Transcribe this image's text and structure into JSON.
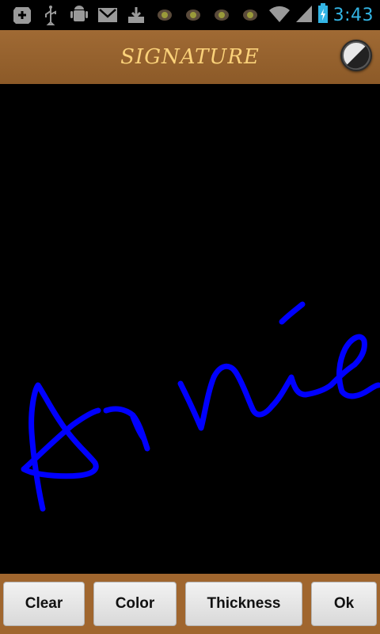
{
  "status_bar": {
    "time": "3:43",
    "left_icons": [
      "add-icon",
      "usb-icon",
      "android-debug-icon",
      "gmail-icon",
      "download-icon",
      "camera-icon",
      "camera-icon",
      "camera-icon",
      "camera-icon"
    ],
    "right_icons": [
      "wifi-icon",
      "signal-icon",
      "battery-icon"
    ],
    "accent": "#33b5e5"
  },
  "header": {
    "title": "SIGNATURE",
    "action_icon": "contrast-icon",
    "background": "#965f2c",
    "title_color": "#fbd27a"
  },
  "canvas": {
    "background": "#000000",
    "stroke_color": "#0000ff",
    "signature_text": "Arnie"
  },
  "toolbar": {
    "clear_label": "Clear",
    "color_label": "Color",
    "thickness_label": "Thickness",
    "ok_label": "Ok"
  }
}
